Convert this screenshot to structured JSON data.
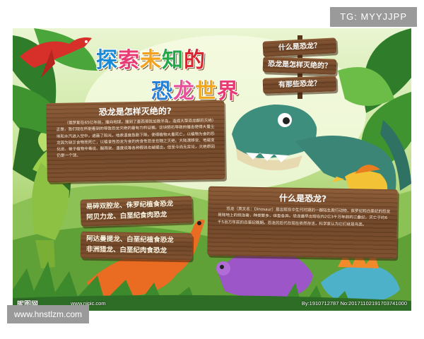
{
  "watermarks": {
    "top_right": "TG: MYYJJPP",
    "bottom_left": "www.hnstlzm.com"
  },
  "poster": {
    "title_line1": [
      "探",
      "索",
      "未",
      "知",
      "的"
    ],
    "title_line2": [
      "恐",
      "龙",
      "世",
      "界"
    ],
    "nav": [
      "什么是恐龙？",
      "恐龙是怎样灭绝的？",
      "有那些恐龙？"
    ],
    "panel_extinction": {
      "title": "恐龙是怎样灭绝的?",
      "text": "（俄罗斯在65亿年前，撞向地球，撞到了墨西哥犹加敦半岛，造成大型恐龙群的灭绝）正是，我们现在所能看到的导致恐龙灭绝的最有力的证据。这块陨石导致的撞击使得大量尘埃和水汽进入空中，遮蔽了阳光，地表温度急剧下降，使得植物大量死亡，以植物为食的恐龙因为缺乏食物而死亡，以植食性恐龙为食的肉食性恐龙也随之灭绝。大陆漂移说、地磁变化说、被子植物中毒说、酸雨说、温度说等各种假说也被提出，但至今尚无定论，灭绝原因仍是一个谜。"
    },
    "list": {
      "line1": "易碎双腔龙、侏罗纪植食恐龙",
      "line2": "阿贝力龙、白垩纪食肉恐龙",
      "line3": "阿达曼提龙、白垩纪植食恐龙",
      "line4": "非洲猎龙、白垩纪肉食恐龙"
    },
    "panel_what": {
      "title": "什么是恐龙?",
      "text": "恐龙（英文名：Dinosaur）是出现在中生代时期的一群陆生爬行动物，侏罗纪和白垩纪的恐龙是陆地上的统治者，种类繁多，体型各异。恐龙最早出现在约2亿3千万年前的三叠纪，灭亡于约6千5百万年前的白垩纪晚期。恐龙的后代在现在依然存活，科学家认为它们就是鸟类。"
    },
    "logo": "昵图网",
    "site": "www.nipic.com",
    "stamp": "By:1910712787 No:20171102191703741000"
  },
  "colors": {
    "wood": "#6d4224",
    "jungle": "#4d8f2f",
    "trex": "#3e8e7e"
  }
}
